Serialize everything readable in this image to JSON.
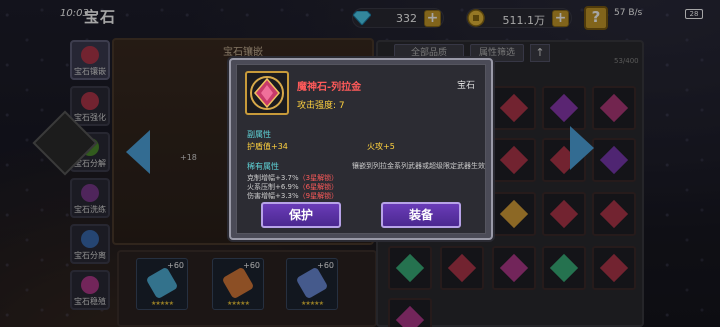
{
  "status_bar": {
    "time": "10:03",
    "net_speed": "57 B/s",
    "battery": "28"
  },
  "header": {
    "title": "宝石",
    "gems": "332",
    "gold": "511.1万",
    "help_label": "?"
  },
  "tabs": [
    {
      "label": "宝石镶嵌",
      "color": "#b0364a"
    },
    {
      "label": "宝石强化",
      "color": "#b0364a"
    },
    {
      "label": "宝石分解",
      "color": "#4d8c2e"
    },
    {
      "label": "宝石洗练",
      "color": "#7a3a8c"
    },
    {
      "label": "宝石分离",
      "color": "#3a6ab0"
    },
    {
      "label": "宝石稳殖",
      "color": "#b03a8a"
    }
  ],
  "inlay_panel": {
    "title": "宝石镶嵌",
    "slot_level": "+18"
  },
  "equipped": [
    {
      "level": "+60",
      "stars": "★★★★★",
      "color": "#4fb0d8"
    },
    {
      "level": "+60",
      "stars": "★★★★★",
      "color": "#d87a3a"
    },
    {
      "level": "+60",
      "stars": "★★★★★",
      "color": "#6a8ad8"
    }
  ],
  "inventory": {
    "filter_all": "全部品质",
    "filter_attr": "属性筛选",
    "sort_icon": "↑",
    "count": "53/400",
    "cells": [
      {
        "color": "#b0364a"
      },
      {
        "color": "#8a3ab0"
      },
      {
        "color": "#b03a7a"
      },
      {
        "color": "#b0364a"
      },
      {
        "color": "#b0364a"
      },
      {
        "color": "#7a3ab0"
      },
      {
        "color": "#d8a03a"
      },
      {
        "color": "#b0364a"
      },
      {
        "color": "#b0364a"
      },
      {
        "color": "#3ab07a"
      },
      {
        "color": "#b0364a"
      },
      {
        "color": "#b03a8a"
      },
      {
        "color": "#3ab07a"
      },
      {
        "color": "#b0364a"
      },
      {
        "color": "#b03a8a"
      }
    ]
  },
  "gem_popup": {
    "name": "魔神石-列拉金",
    "type": "宝石",
    "attack": "攻击强度: 7",
    "sub_label": "副属性",
    "sub_stat_1": "护盾值+34",
    "sub_stat_2": "火攻+5",
    "rare_label": "稀有属性",
    "rare_note": "镶嵌到列拉金系列武器或超级限定武器生效",
    "rare_1": {
      "text": "克制增幅+3.7%",
      "lock": "（3星解锁）"
    },
    "rare_2": {
      "text": "火系压制+6.9%",
      "lock": "（6星解锁）"
    },
    "rare_3": {
      "text": "伤害增幅+3.3%",
      "lock": "（9星解锁）"
    },
    "btn_protect": "保护",
    "btn_equip": "装备"
  }
}
